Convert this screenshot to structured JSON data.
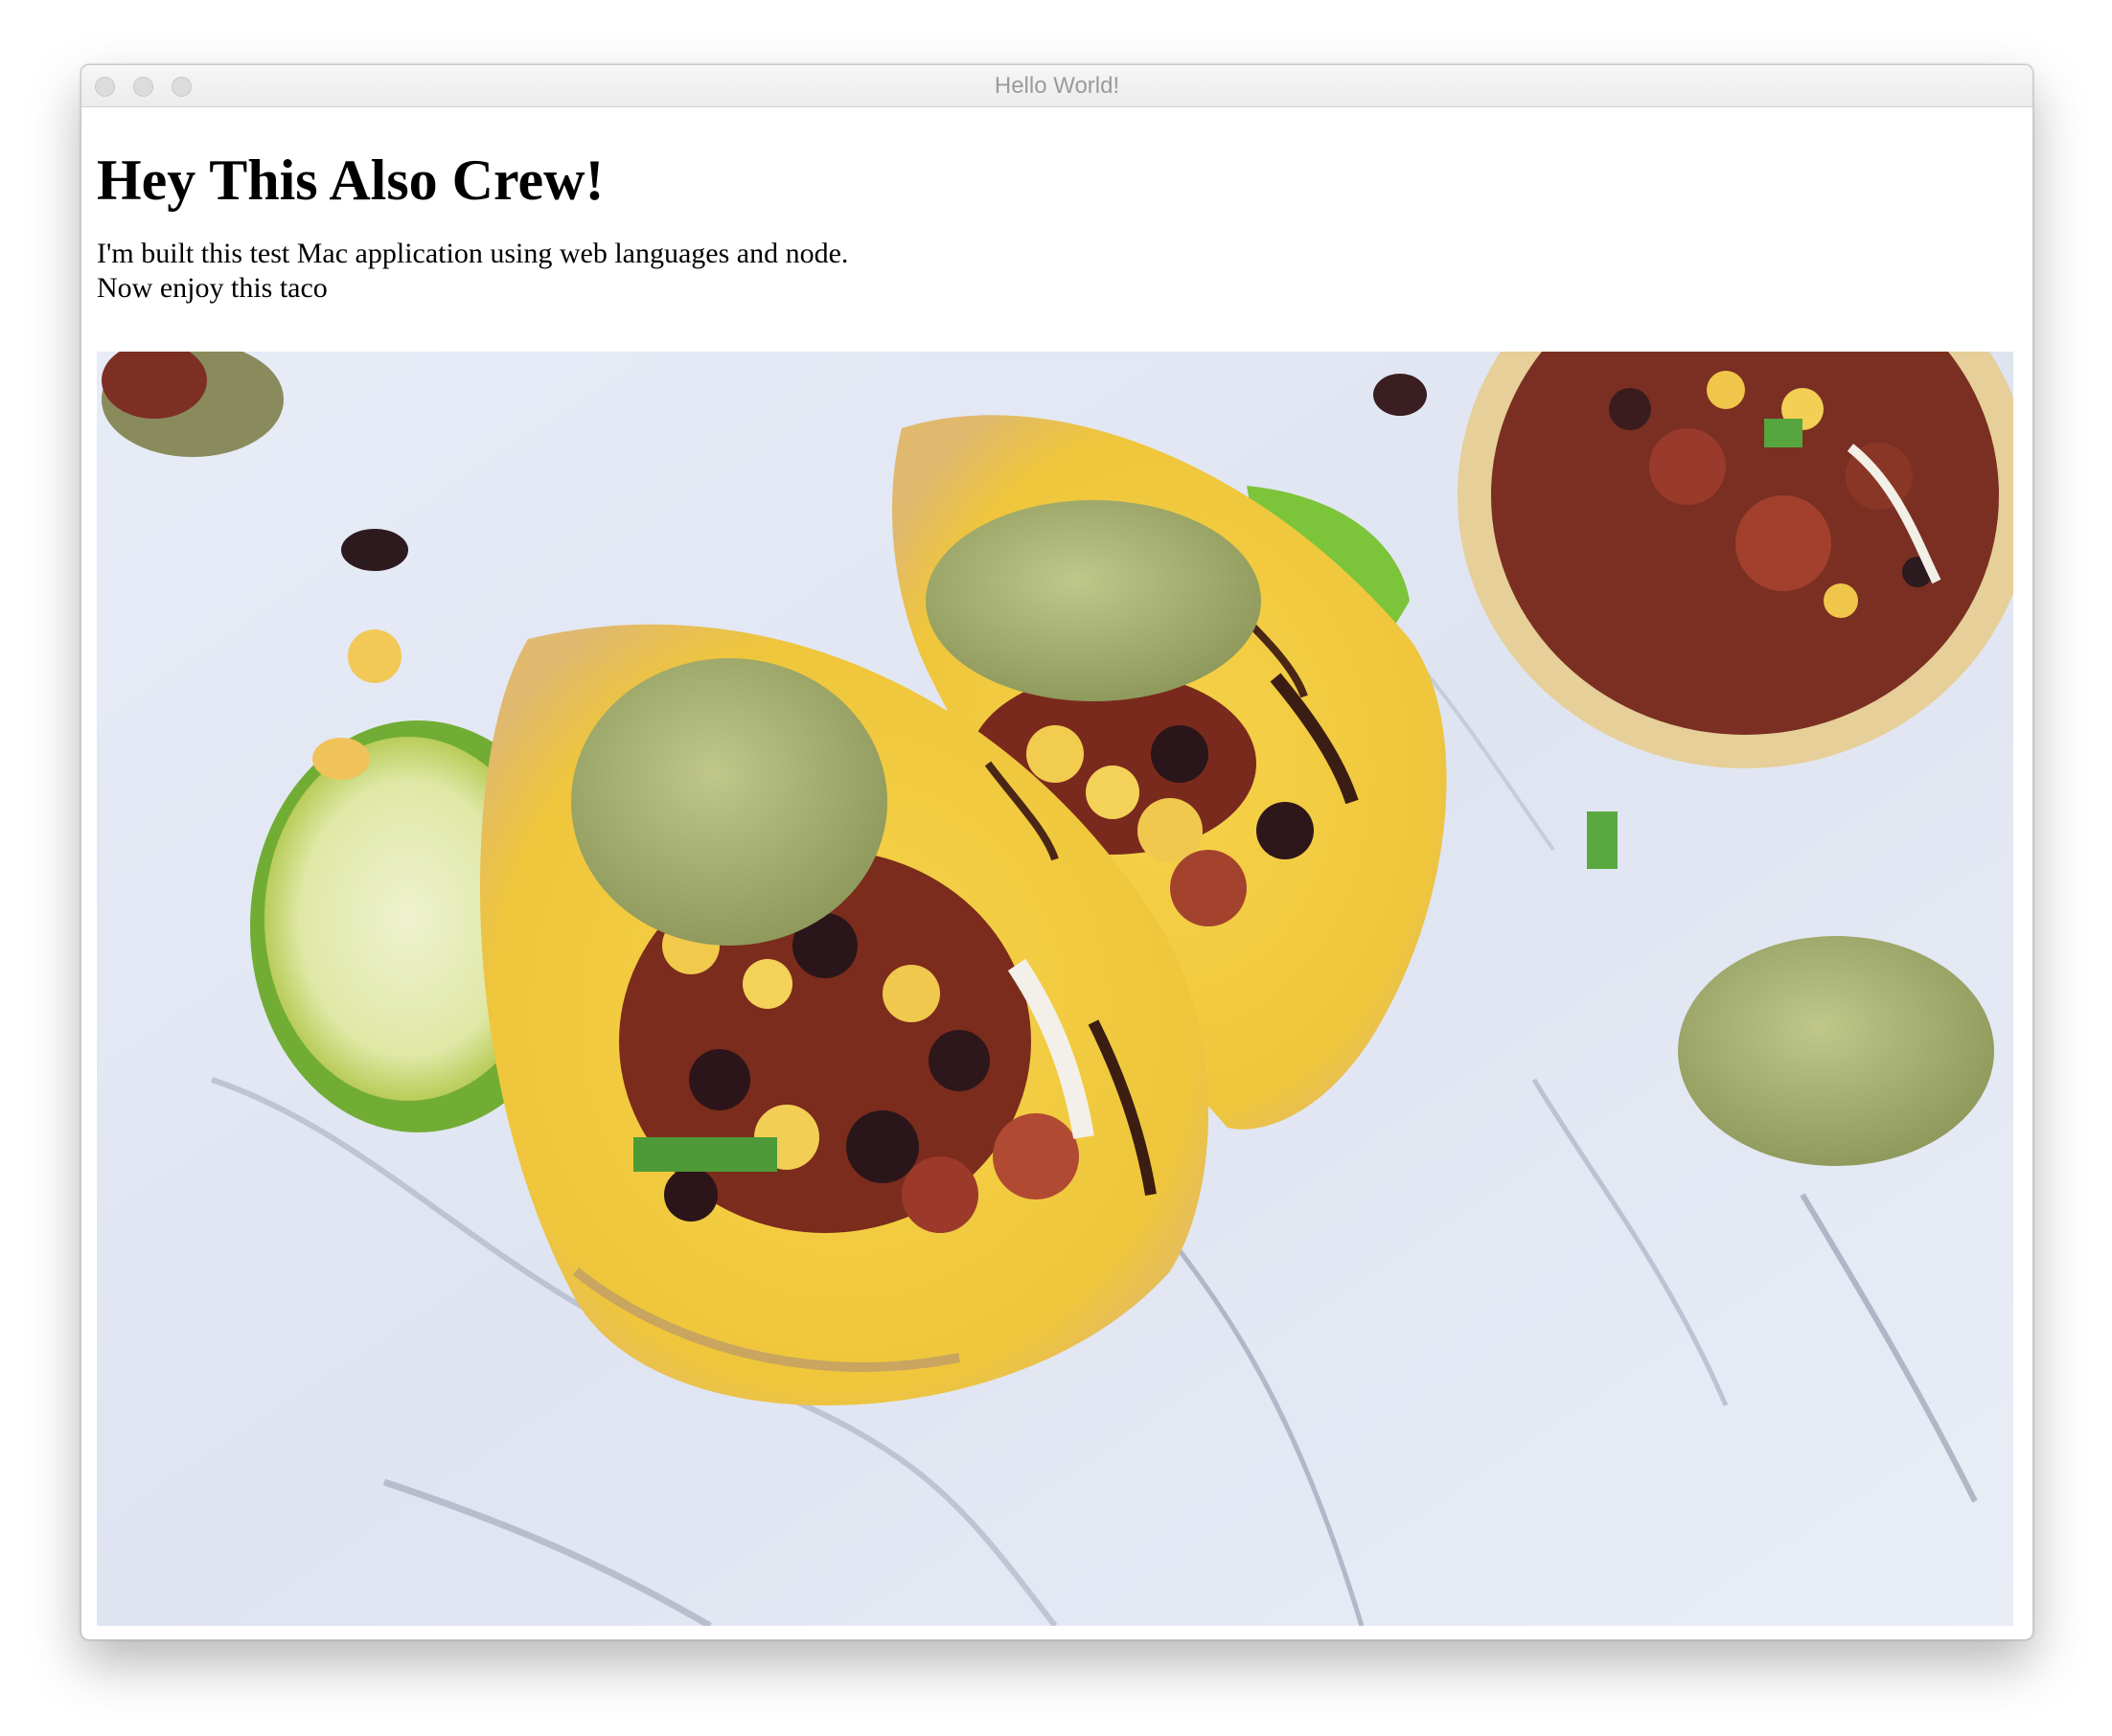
{
  "window": {
    "title": "Hello World!"
  },
  "page": {
    "heading": "Hey This Also Crew!",
    "lines": [
      "I'm built this test Mac application using web languages and node.",
      "Now enjoy this taco"
    ]
  },
  "image": {
    "description_icon": "taco-photo"
  }
}
